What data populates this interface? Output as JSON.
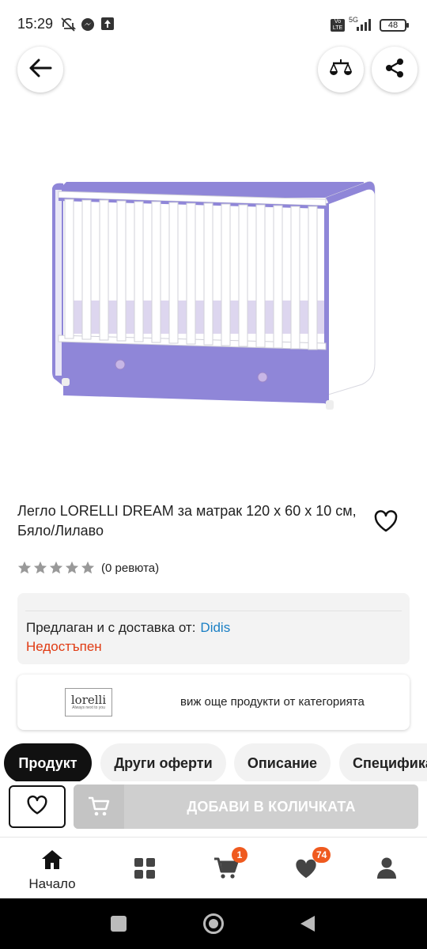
{
  "status_bar": {
    "time": "15:29",
    "network": "5G",
    "volte": "Vo LTE",
    "battery": "48"
  },
  "header": {
    "back_icon": "arrow-left-icon",
    "compare_icon": "scales-icon",
    "share_icon": "share-icon"
  },
  "product": {
    "title": "Легло LORELLI DREAM за матрак 120 x 60 x 10 см, Бяло/Лилаво",
    "rating_stars": 0,
    "reviews_text": "(0 ревюта)"
  },
  "seller": {
    "label": "Предлаган и с доставка от:",
    "name": "Didis",
    "availability": "Недостъпен"
  },
  "brand": {
    "logo_text": "lorelli",
    "logo_subtext": "Always next to you",
    "more_link": "виж още продукти от категорията"
  },
  "tabs": [
    {
      "label": "Продукт",
      "active": true
    },
    {
      "label": "Други оферти",
      "active": false
    },
    {
      "label": "Описание",
      "active": false
    },
    {
      "label": "Спецификации",
      "active": false
    }
  ],
  "actions": {
    "add_to_cart": "ДОБАВИ В КОЛИЧКАТА"
  },
  "bottom_nav": {
    "home_label": "Начало",
    "cart_badge": "1",
    "favorites_badge": "74"
  },
  "colors": {
    "accent": "#ef5a1f",
    "link": "#1a7fc4",
    "unavailable": "#e03a12",
    "crib_purple": "#8f86d8"
  }
}
